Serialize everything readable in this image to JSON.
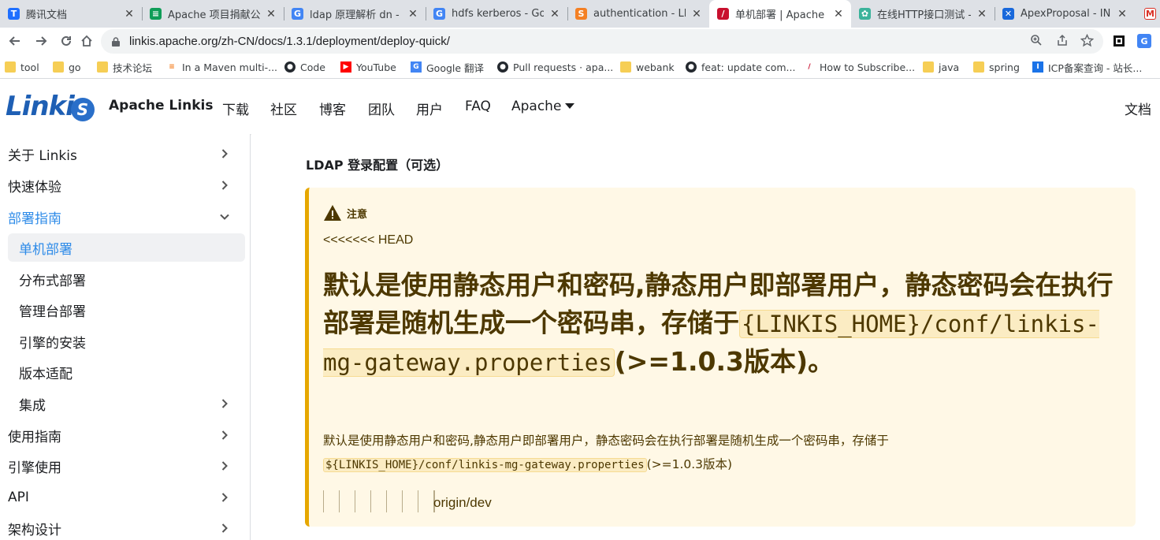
{
  "browser": {
    "tabs": [
      {
        "title": "腾讯文档",
        "icon": "tencent-docs-icon",
        "color": "#1e6fff",
        "glyph": "T"
      },
      {
        "title": "Apache 项目捐献公司",
        "icon": "google-sheets-icon",
        "color": "#0f9d58",
        "glyph": "≡"
      },
      {
        "title": "ldap 原理解析 dn - G",
        "icon": "google-icon",
        "color": "#4285f4",
        "glyph": "G"
      },
      {
        "title": "hdfs kerberos - Goo",
        "icon": "google-icon",
        "color": "#4285f4",
        "glyph": "G"
      },
      {
        "title": "authentication - LDA",
        "icon": "stackoverflow-icon",
        "color": "#f48024",
        "glyph": "S"
      },
      {
        "title": "单机部署 | Apache Li",
        "icon": "apache-feather-icon",
        "color": "#c8102e",
        "glyph": "/"
      },
      {
        "title": "在线HTTP接口测试 -",
        "icon": "gear-icon",
        "color": "#3bb39b",
        "glyph": "✿"
      },
      {
        "title": "ApexProposal - INC",
        "icon": "confluence-icon",
        "color": "#1868db",
        "glyph": "✕"
      }
    ],
    "url": "linkis.apache.org/zh-CN/docs/1.3.1/deployment/deploy-quick/",
    "bookmarks": [
      {
        "label": "tool",
        "icon": "folder-icon"
      },
      {
        "label": "go",
        "icon": "folder-icon"
      },
      {
        "label": "技术论坛",
        "icon": "folder-icon"
      },
      {
        "label": "In a Maven multi-...",
        "icon": "stackoverflow-icon"
      },
      {
        "label": "Code",
        "icon": "github-icon"
      },
      {
        "label": "YouTube",
        "icon": "youtube-icon"
      },
      {
        "label": "Google 翻译",
        "icon": "google-translate-icon"
      },
      {
        "label": "Pull requests · apa...",
        "icon": "github-icon"
      },
      {
        "label": "webank",
        "icon": "folder-icon"
      },
      {
        "label": "feat: update com...",
        "icon": "github-icon"
      },
      {
        "label": "How to Subscribe...",
        "icon": "apache-feather-icon"
      },
      {
        "label": "java",
        "icon": "folder-icon"
      },
      {
        "label": "spring",
        "icon": "folder-icon"
      },
      {
        "label": "ICP备案查询 - 站长...",
        "icon": "icp-icon"
      }
    ]
  },
  "site": {
    "logo_text": "Linki",
    "logo_letter": "S",
    "name": "Apache Linkis",
    "nav": [
      "下载",
      "社区",
      "博客",
      "团队",
      "用户",
      "FAQ"
    ],
    "nav_apache": "Apache",
    "nav_docs": "文档"
  },
  "sidebar": {
    "items": [
      {
        "label": "关于 Linkis",
        "chevron": "right"
      },
      {
        "label": "快速体验",
        "chevron": "right"
      },
      {
        "label": "部署指南",
        "chevron": "down"
      },
      {
        "label": "单机部署"
      },
      {
        "label": "分布式部署"
      },
      {
        "label": "管理台部署"
      },
      {
        "label": "引擎的安装"
      },
      {
        "label": "版本适配"
      },
      {
        "label": "集成",
        "chevron": "right"
      },
      {
        "label": "使用指南",
        "chevron": "right"
      },
      {
        "label": "引擎使用",
        "chevron": "right"
      },
      {
        "label": "API",
        "chevron": "right"
      },
      {
        "label": "架构设计",
        "chevron": "right"
      }
    ]
  },
  "content": {
    "heading": "LDAP 登录配置（可选）",
    "admonition_title": "注意",
    "conflict_head": "<<<<<<< HEAD",
    "big_heading_pre": "默认是使用静态用户和密码,静态用户即部署用户，静态密码会在执行部署是随机生成一个密码串，存储于",
    "big_heading_code": "{LINKIS_HOME}/conf/linkis-mg-gateway.properties",
    "big_heading_post": "(>=1.0.3版本)。",
    "para_pre": "默认是使用静态用户和密码,静态用户即部署用户，静态密码会在执行部署是随机生成一个密码串，存储于",
    "para_code": "${LINKIS_HOME}/conf/linkis-mg-gateway.properties",
    "para_post": "(>=1.0.3版本)",
    "conflict_bar_count": 7,
    "conflict_tail": "origin/dev"
  },
  "colors": {
    "accent": "#2e8be8",
    "admonition_bg": "#fff8e6",
    "admonition_border": "#e6a700"
  }
}
